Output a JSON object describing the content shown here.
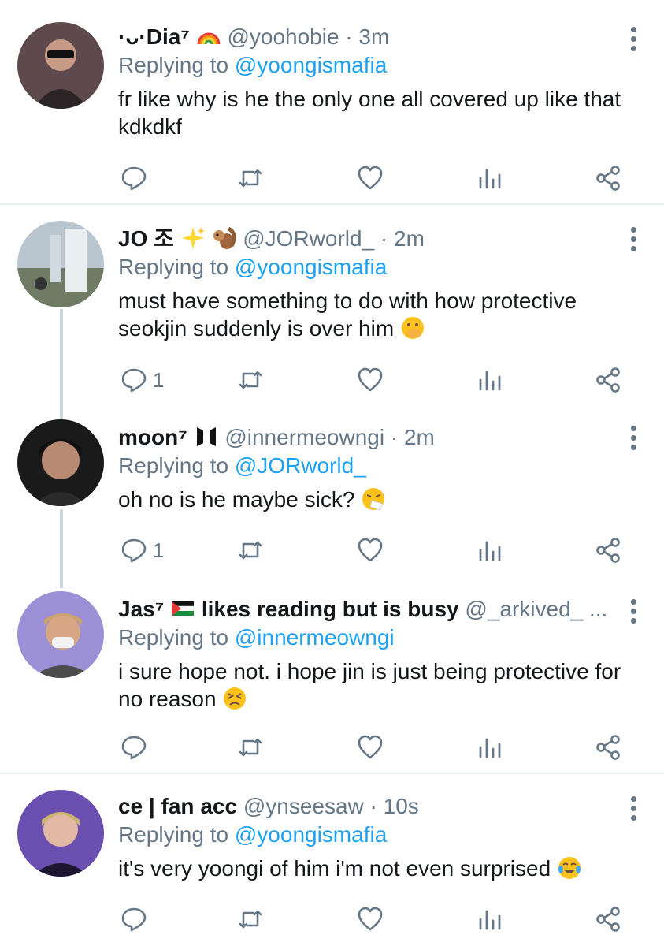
{
  "tweets": [
    {
      "name": "·ᴗ·Dia⁷",
      "handle": "@yoohobie · 3m",
      "replying_prefix": "Replying to",
      "replying_to": "@yoongismafia",
      "text": "fr like why is he the only one all covered up like that kdkdkf",
      "reply_count": ""
    },
    {
      "name": "JO 조",
      "handle": "@JORworld_ · 2m",
      "replying_prefix": "Replying to",
      "replying_to": "@yoongismafia",
      "text": "must have something to do with how protective seokjin suddenly is over him",
      "reply_count": "1"
    },
    {
      "name": "moon⁷",
      "handle": "@innermeowngi · 2m",
      "replying_prefix": "Replying to",
      "replying_to": "@JORworld_",
      "text": "oh no is he maybe sick?",
      "reply_count": "1"
    },
    {
      "name": "Jas⁷",
      "name_suffix": "likes reading but is busy",
      "handle": "@_arkived_ ...",
      "replying_prefix": "Replying to",
      "replying_to": "@innermeowngi",
      "text": "i sure hope not. i hope jin is just being protective for no reason",
      "reply_count": ""
    },
    {
      "name": "ce | fan acc",
      "handle": "@ynseesaw · 10s",
      "replying_prefix": "Replying to",
      "replying_to": "@yoongismafia",
      "text": "it's very yoongi of him i'm not even surprised",
      "reply_count": ""
    }
  ],
  "colors": {
    "link": "#1da1f2",
    "muted": "#657786",
    "separator": "#e6ecf0",
    "thread_line": "#ccd6dd"
  },
  "icons": [
    "rainbow-emoji",
    "sparkles-emoji",
    "chipmunk-emoji",
    "palestine-flag-emoji",
    "reply-icon",
    "retweet-icon",
    "like-icon",
    "analytics-icon",
    "share-icon",
    "more-icon"
  ]
}
